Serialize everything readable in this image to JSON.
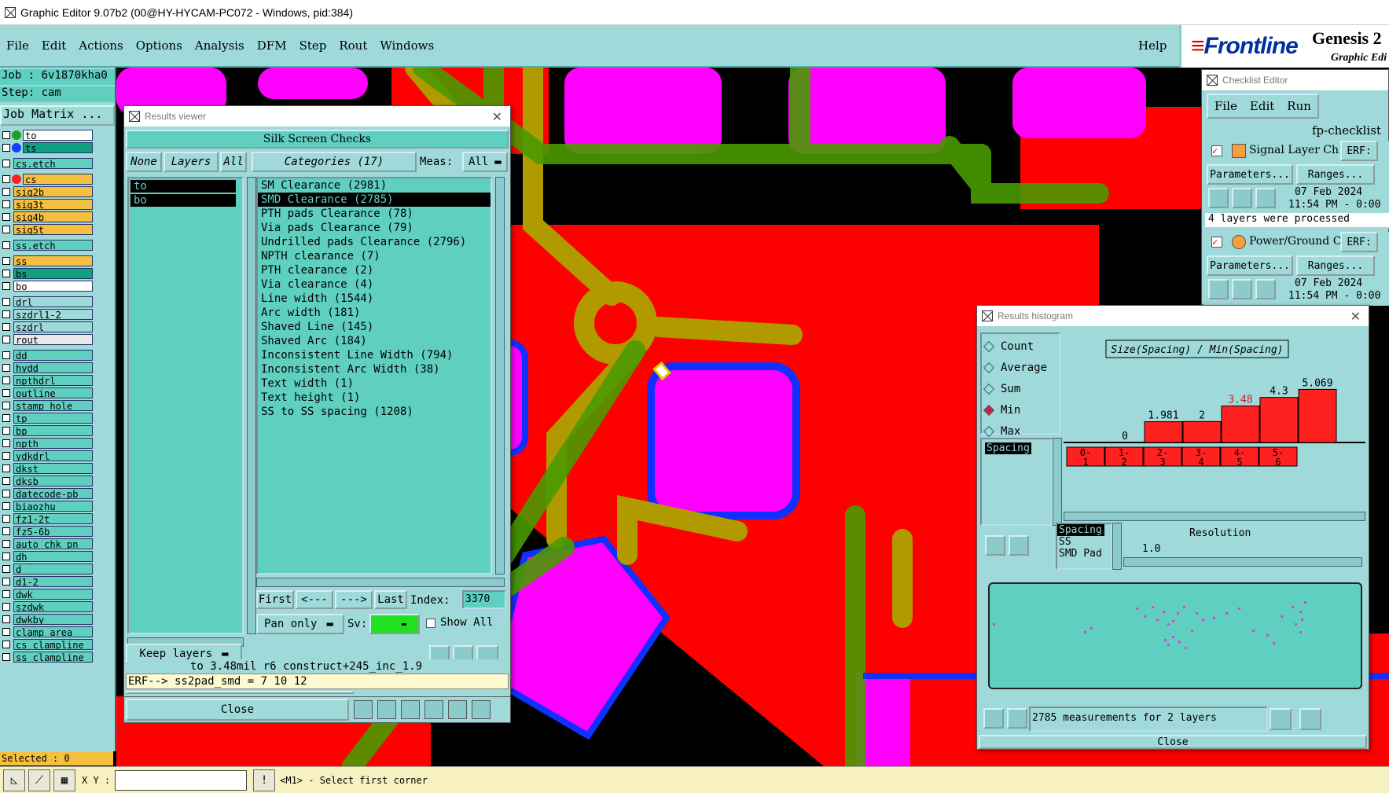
{
  "window": {
    "title": "Graphic Editor 9.07b2 (00@HY-HYCAM-PC072 - Windows, pid:384)"
  },
  "menu": {
    "items": [
      "File",
      "Edit",
      "Actions",
      "Options",
      "Analysis",
      "DFM",
      "Step",
      "Rout",
      "Windows"
    ],
    "help": "Help"
  },
  "brand": {
    "logo": "Frontline",
    "name": "Genesis 2",
    "subtitle": "Graphic Edi"
  },
  "left_panel": {
    "job": "Job : 6v1870kha0",
    "step": "Step: cam",
    "job_matrix": "Job Matrix ...",
    "layers": [
      {
        "name": "to",
        "bg": "#ffffff",
        "dot": "#20a020"
      },
      {
        "name": "ts",
        "bg": "#10a080",
        "dot": "#1040ff"
      },
      {
        "sep": true
      },
      {
        "name": "cs.etch",
        "bg": "#5fd0c0"
      },
      {
        "sep": true
      },
      {
        "name": "cs",
        "bg": "#f5c040",
        "dot": "#ff2020"
      },
      {
        "name": "sig2b",
        "bg": "#f5c040"
      },
      {
        "name": "sig3t",
        "bg": "#f5c040"
      },
      {
        "name": "sig4b",
        "bg": "#f5c040"
      },
      {
        "name": "sig5t",
        "bg": "#f5c040"
      },
      {
        "sep": true
      },
      {
        "name": "ss.etch",
        "bg": "#5fd0c0"
      },
      {
        "sep": true
      },
      {
        "name": "ss",
        "bg": "#f5c040"
      },
      {
        "name": "bs",
        "bg": "#10a080"
      },
      {
        "name": "bo",
        "bg": "#ffffff"
      },
      {
        "sep": true
      },
      {
        "name": "drl",
        "bg": "#9fd9d9"
      },
      {
        "name": "szdrl1-2",
        "bg": "#9fd9d9"
      },
      {
        "name": "szdrl",
        "bg": "#9fd9d9"
      },
      {
        "name": "rout",
        "bg": "#e8e8e8"
      },
      {
        "sep": true
      },
      {
        "name": "dd",
        "bg": "#5fd0c0"
      },
      {
        "name": "hydd",
        "bg": "#5fd0c0"
      },
      {
        "name": "npthdrl",
        "bg": "#5fd0c0"
      },
      {
        "name": "outline",
        "bg": "#5fd0c0"
      },
      {
        "name": "stamp_hole",
        "bg": "#5fd0c0"
      },
      {
        "name": "tp",
        "bg": "#5fd0c0"
      },
      {
        "name": "bp",
        "bg": "#5fd0c0"
      },
      {
        "name": "npth",
        "bg": "#5fd0c0"
      },
      {
        "name": "ydkdrl",
        "bg": "#5fd0c0"
      },
      {
        "name": "dkst",
        "bg": "#5fd0c0"
      },
      {
        "name": "dksb",
        "bg": "#5fd0c0"
      },
      {
        "name": "datecode-pb",
        "bg": "#5fd0c0"
      },
      {
        "name": "biaozhu",
        "bg": "#5fd0c0"
      },
      {
        "name": "fz1-2t",
        "bg": "#5fd0c0"
      },
      {
        "name": "fz5-6b",
        "bg": "#5fd0c0"
      },
      {
        "name": "auto_chk_pn",
        "bg": "#5fd0c0"
      },
      {
        "name": "dh",
        "bg": "#5fd0c0"
      },
      {
        "name": "d",
        "bg": "#5fd0c0"
      },
      {
        "name": "d1-2",
        "bg": "#5fd0c0"
      },
      {
        "name": "dwk",
        "bg": "#5fd0c0"
      },
      {
        "name": "szdwk",
        "bg": "#5fd0c0"
      },
      {
        "name": "dwkby",
        "bg": "#5fd0c0"
      },
      {
        "name": "clamp_area",
        "bg": "#5fd0c0"
      },
      {
        "name": "cs_clampline",
        "bg": "#5fd0c0"
      },
      {
        "name": "ss_clampline",
        "bg": "#5fd0c0"
      }
    ],
    "selected": "Selected : 0"
  },
  "bottom_bar": {
    "xy_label": "X Y :",
    "message": "<M1> - Select first corner"
  },
  "results_viewer": {
    "title": "Results viewer",
    "header": "Silk Screen Checks",
    "none_btn": "None",
    "layers_btn": "Layers",
    "all_btn": "All",
    "categories_btn": "Categories (17)",
    "meas_label": "Meas:",
    "meas_value": "All",
    "layers": [
      "to",
      "bo"
    ],
    "categories": [
      "SM Clearance (2981)",
      "SMD Clearance (2785)",
      "PTH pads Clearance (78)",
      "Via pads Clearance (79)",
      "Undrilled pads Clearance (2796)",
      "NPTH clearance (7)",
      "PTH clearance (2)",
      "Via clearance (4)",
      "Line width (1544)",
      "Arc width (181)",
      "Shaved Line (145)",
      "Shaved Arc (184)",
      "Inconsistent Line Width (794)",
      "Inconsistent Arc Width (38)",
      "Text width (1)",
      "Text height (1)",
      "SS to SS spacing (1208)"
    ],
    "selected_index": 1,
    "first_btn": "First",
    "prev_btn": "<---",
    "next_btn": "--->",
    "last_btn": "Last",
    "index_label": "Index:",
    "index_value": "3370",
    "pan_value": "Pan only",
    "sv_label": "Sv:",
    "show_all": "Show All",
    "keep_layers": "Keep layers",
    "status_line": "to 3.48mil  r6  construct+245_inc_1.9",
    "erf_line": "ERF--> ss2pad_smd = 7 10 12",
    "close_btn": "Close"
  },
  "checklist_editor": {
    "title": "Checklist Editor",
    "menu": [
      "File",
      "Edit",
      "Run"
    ],
    "checklist_name": "fp-checklist",
    "items": [
      {
        "name": "Signal Layer Ch",
        "erf": "ERF:",
        "date": "07 Feb 2024",
        "time": "11:54 PM - 0:00",
        "message": "4 layers were processed"
      },
      {
        "name": "Power/Ground C",
        "erf": "ERF:",
        "date": "07 Feb 2024",
        "time": "11:54 PM - 0:00"
      }
    ],
    "params_btn": "Parameters...",
    "ranges_btn": "Ranges..."
  },
  "histogram": {
    "title": "Results histogram",
    "modes": [
      "Count",
      "Average",
      "Sum",
      "Min",
      "Max"
    ],
    "selected_mode": "Min",
    "list_selected": "Spacing",
    "plot_title": "Size(Spacing) / Min(Spacing)",
    "resolution_label": "Resolution",
    "resolution_value": "1.0",
    "filter_list": [
      "Spacing",
      "SS",
      "SMD Pad"
    ],
    "summary": "2785 measurements for 2 layers",
    "close_btn": "Close"
  },
  "chart_data": {
    "type": "bar",
    "title": "Size(Spacing) / Min(Spacing)",
    "categories": [
      "0-1",
      "1-2",
      "2-3",
      "3-4",
      "4-5",
      "5-6"
    ],
    "values": [
      0,
      1.981,
      2,
      3.48,
      4.3,
      5.069
    ],
    "value_labels": [
      "0",
      "1.981",
      "2",
      "3.48",
      "4.3",
      "5.069"
    ],
    "highlight_index": 3,
    "bar_color": "#ff2020",
    "highlight_label_color": "#d02020"
  },
  "colors": {
    "panel": "#9fd9d9",
    "list_bg": "#5fd0c0",
    "copper": "#ff0000",
    "pad": "#ff00ff",
    "trace": "#b0a000"
  }
}
